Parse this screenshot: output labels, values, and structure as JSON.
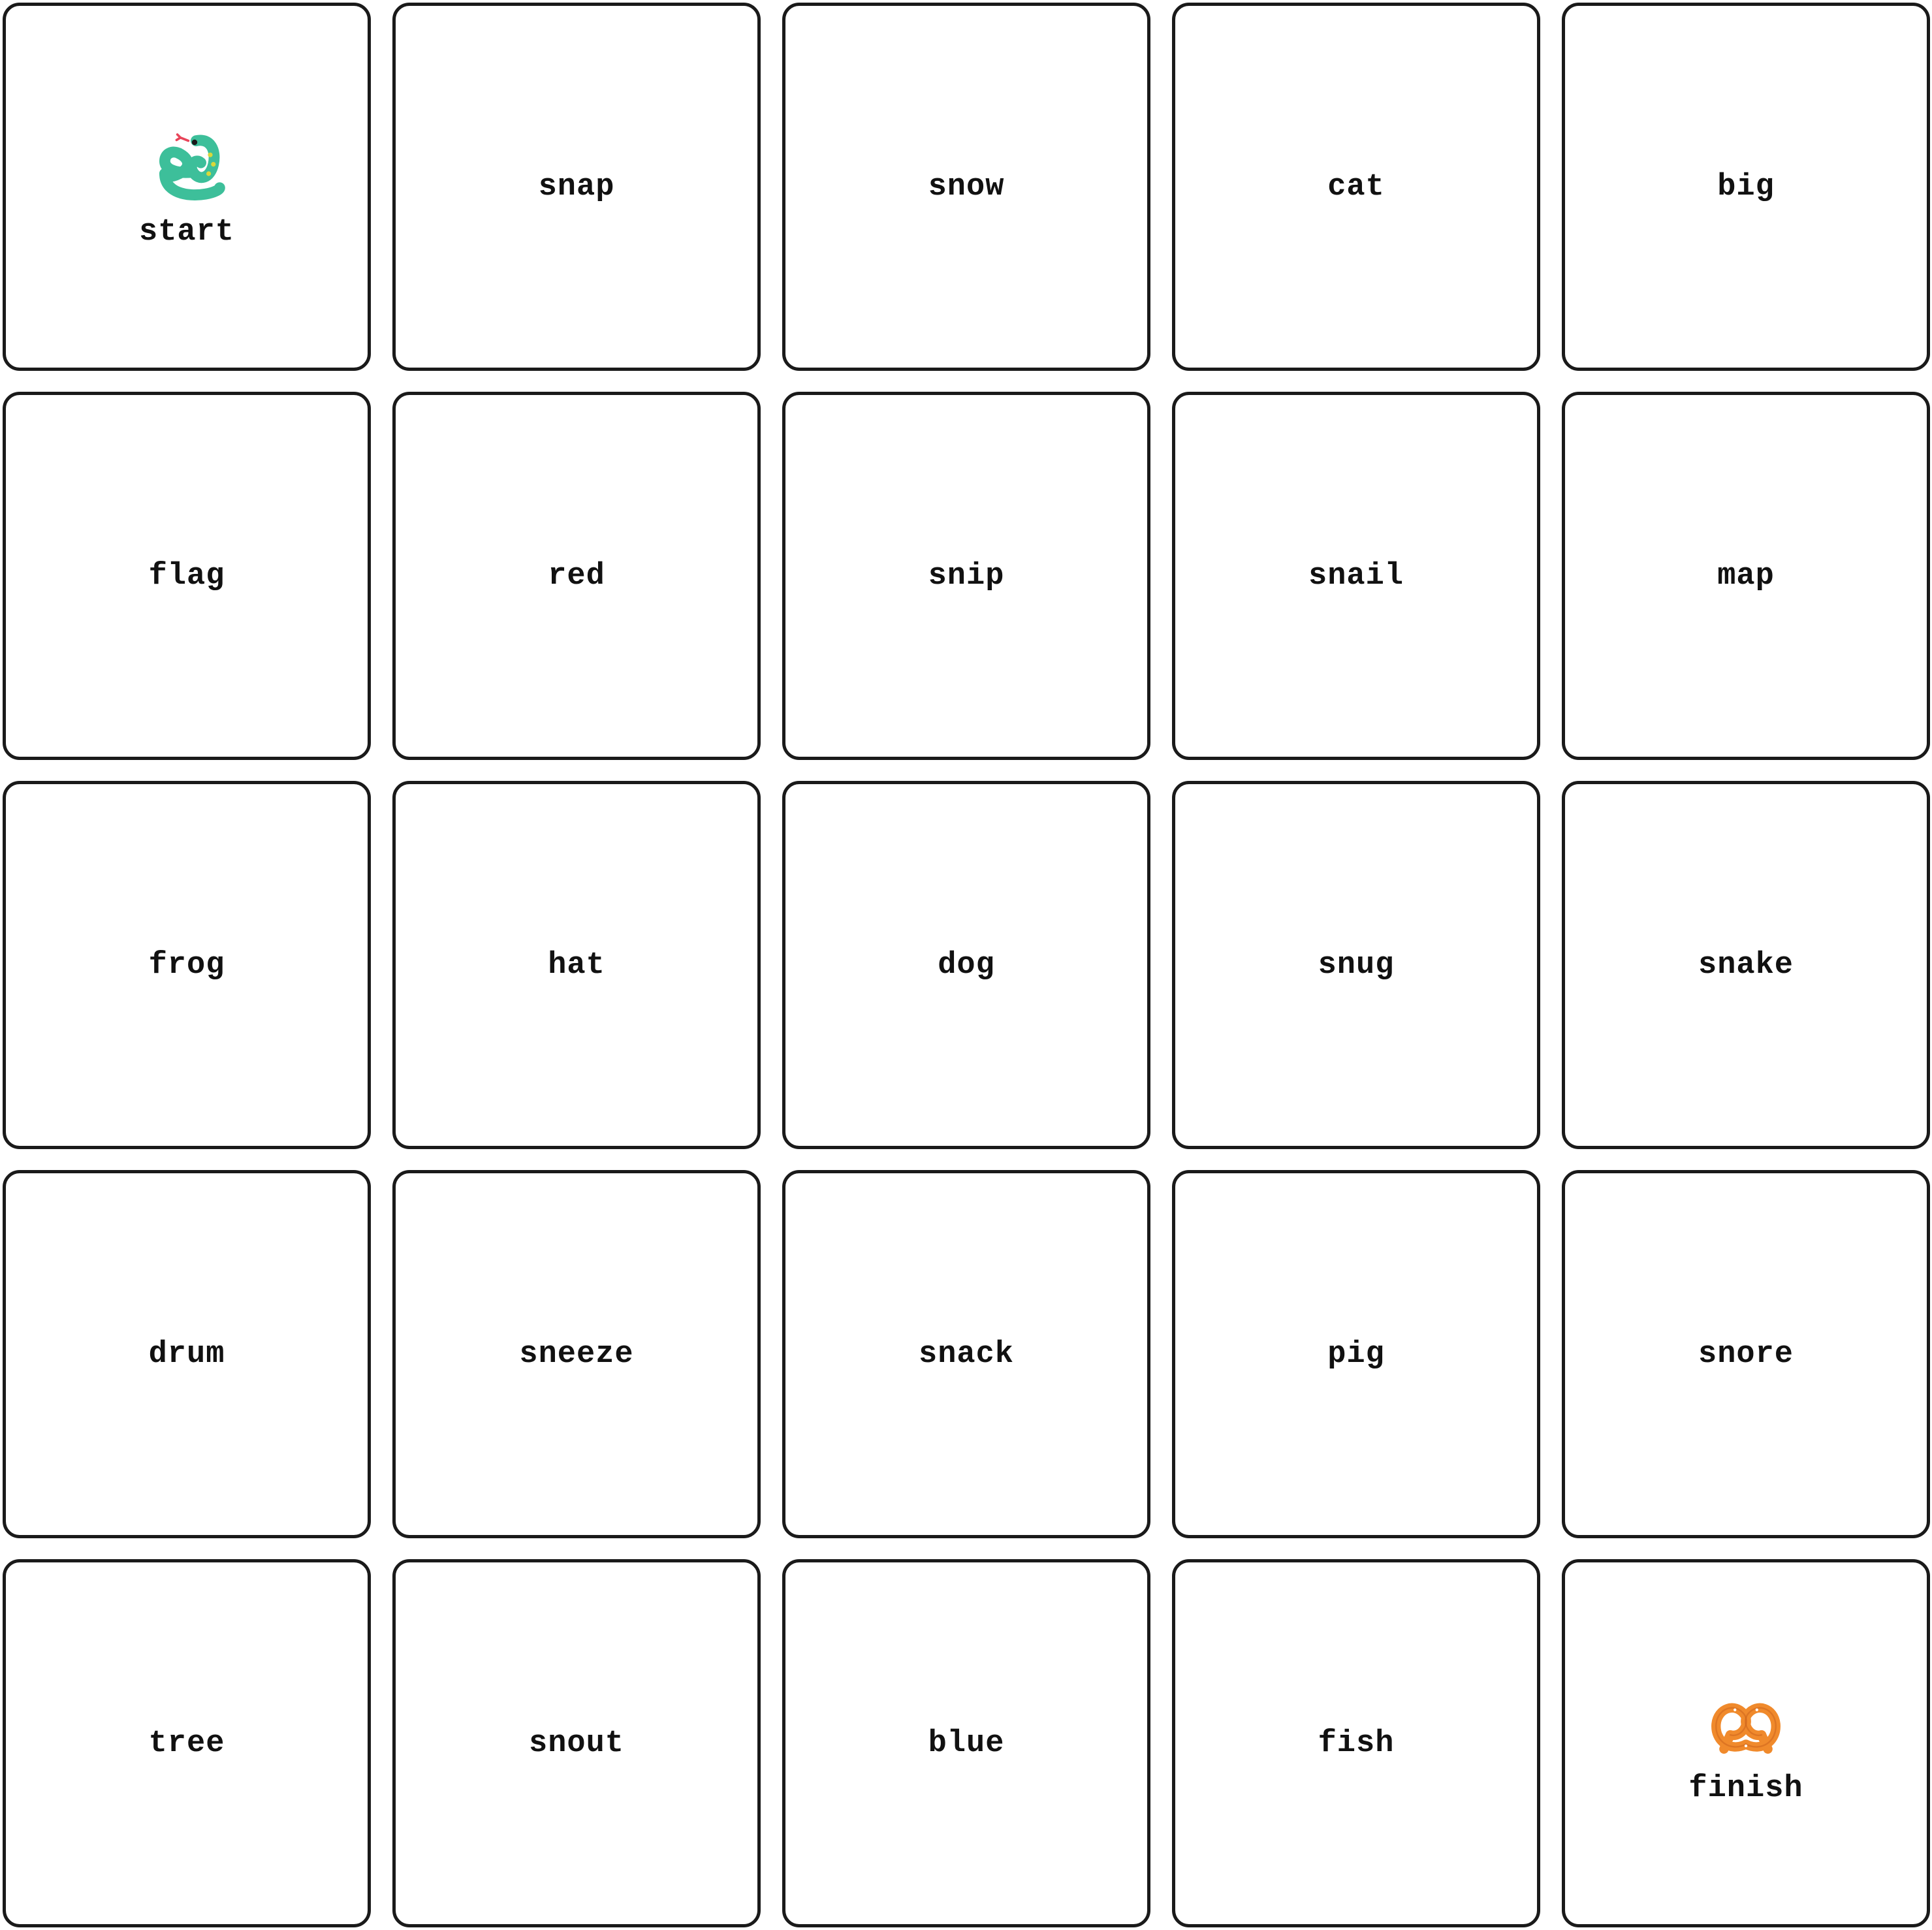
{
  "board": {
    "cells": [
      {
        "word": "start",
        "icon": "snake-icon"
      },
      {
        "word": "snap"
      },
      {
        "word": "snow"
      },
      {
        "word": "cat"
      },
      {
        "word": "big"
      },
      {
        "word": "flag"
      },
      {
        "word": "red"
      },
      {
        "word": "snip"
      },
      {
        "word": "snail"
      },
      {
        "word": "map"
      },
      {
        "word": "frog"
      },
      {
        "word": "hat"
      },
      {
        "word": "dog"
      },
      {
        "word": "snug"
      },
      {
        "word": "snake"
      },
      {
        "word": "drum"
      },
      {
        "word": "sneeze"
      },
      {
        "word": "snack"
      },
      {
        "word": "pig"
      },
      {
        "word": "snore"
      },
      {
        "word": "tree"
      },
      {
        "word": "snout"
      },
      {
        "word": "blue"
      },
      {
        "word": "fish"
      },
      {
        "word": "finish",
        "icon": "pretzel-icon"
      }
    ]
  },
  "colors": {
    "tile_border": "#1a1a1a",
    "snake_green": "#3dbf9a",
    "snake_spots": "#d8d83a",
    "snake_tongue": "#e8455a",
    "pretzel_orange": "#f08a2c"
  }
}
